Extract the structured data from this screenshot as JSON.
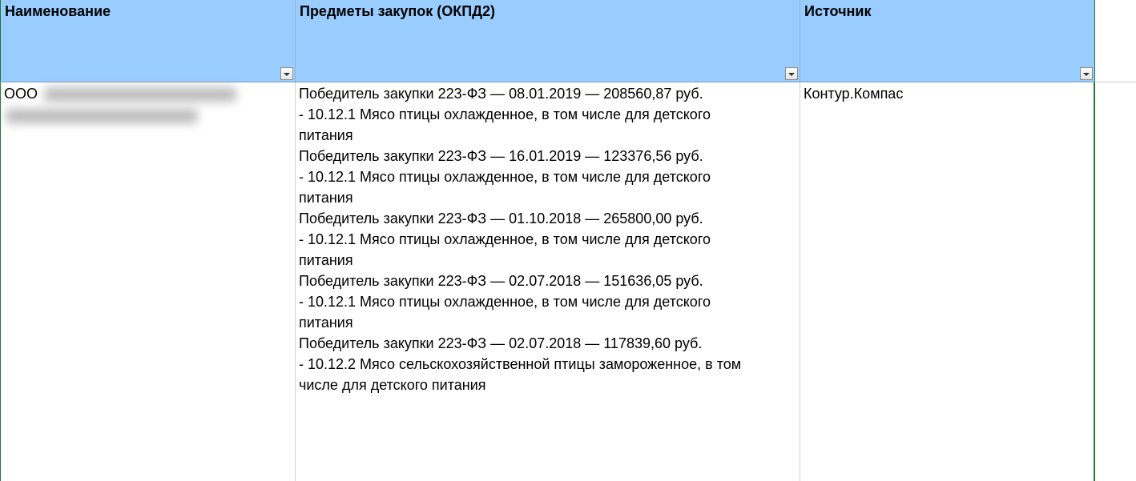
{
  "columns": [
    {
      "label": "Наименование"
    },
    {
      "label": "Предметы закупок (ОКПД2)"
    },
    {
      "label": "Источник"
    }
  ],
  "row": {
    "company_prefix": "ООО",
    "entries": [
      {
        "winner": "Победитель закупки 223-ФЗ — 08.01.2019 — 208560,87 руб.",
        "lines": [
          "- 10.12.1 Мясо птицы охлажденное, в том числе для детского",
          "питания"
        ]
      },
      {
        "winner": "Победитель закупки 223-ФЗ — 16.01.2019 — 123376,56 руб.",
        "lines": [
          "- 10.12.1 Мясо птицы охлажденное, в том числе для детского",
          "питания"
        ]
      },
      {
        "winner": "Победитель закупки 223-ФЗ — 01.10.2018 — 265800,00 руб.",
        "lines": [
          "- 10.12.1 Мясо птицы охлажденное, в том числе для детского",
          "питания"
        ]
      },
      {
        "winner": "Победитель закупки 223-ФЗ — 02.07.2018 — 151636,05 руб.",
        "lines": [
          "- 10.12.1 Мясо птицы охлажденное, в том числе для детского",
          "питания"
        ]
      },
      {
        "winner": "Победитель закупки 223-ФЗ — 02.07.2018 — 117839,60 руб.",
        "lines": [
          "- 10.12.2 Мясо сельскохозяйственной птицы замороженное, в том",
          "числе для детского питания"
        ]
      }
    ],
    "source": "Контур.Компас"
  },
  "icons": {
    "filter": "filter-dropdown-icon"
  },
  "colors": {
    "header_bg": "#99ccff",
    "grid_border": "#1f7a3a"
  }
}
